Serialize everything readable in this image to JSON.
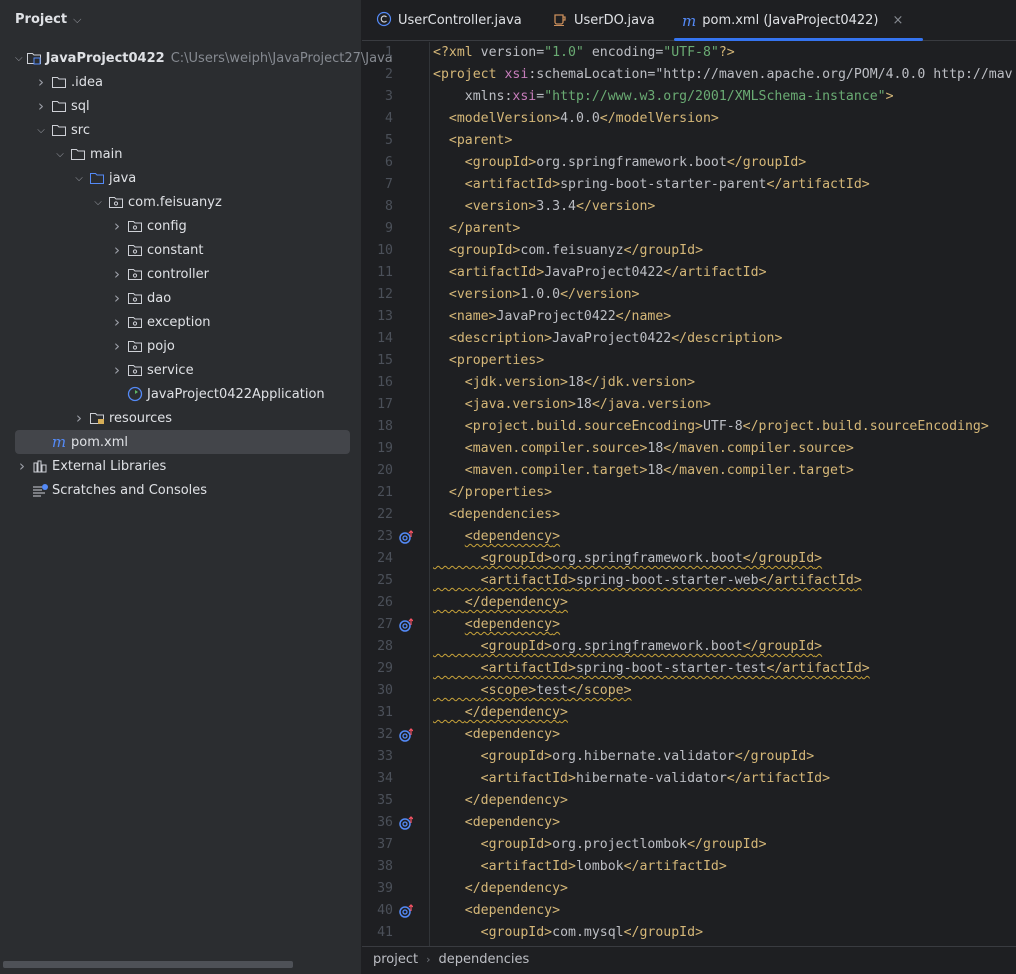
{
  "sidebar": {
    "title": "Project",
    "project_path": "C:\\Users\\weiph\\JavaProject27\\Java",
    "tree": [
      {
        "label": "JavaProject0422",
        "level": 0,
        "chevron": "down",
        "icon": "module-folder-icon",
        "bold": true
      },
      {
        "label": ".idea",
        "level": 1,
        "chevron": "right",
        "icon": "folder-icon"
      },
      {
        "label": "sql",
        "level": 1,
        "chevron": "right",
        "icon": "folder-icon"
      },
      {
        "label": "src",
        "level": 1,
        "chevron": "down",
        "icon": "folder-icon"
      },
      {
        "label": "main",
        "level": 2,
        "chevron": "down",
        "icon": "folder-icon"
      },
      {
        "label": "java",
        "level": 3,
        "chevron": "down",
        "icon": "source-folder-icon"
      },
      {
        "label": "com.feisuanyz",
        "level": 4,
        "chevron": "down",
        "icon": "package-icon"
      },
      {
        "label": "config",
        "level": 5,
        "chevron": "right",
        "icon": "package-icon"
      },
      {
        "label": "constant",
        "level": 5,
        "chevron": "right",
        "icon": "package-icon"
      },
      {
        "label": "controller",
        "level": 5,
        "chevron": "right",
        "icon": "package-icon"
      },
      {
        "label": "dao",
        "level": 5,
        "chevron": "right",
        "icon": "package-icon"
      },
      {
        "label": "exception",
        "level": 5,
        "chevron": "right",
        "icon": "package-icon"
      },
      {
        "label": "pojo",
        "level": 5,
        "chevron": "right",
        "icon": "package-icon"
      },
      {
        "label": "service",
        "level": 5,
        "chevron": "right",
        "icon": "package-icon"
      },
      {
        "label": "JavaProject0422Application",
        "level": 5,
        "chevron": "none",
        "icon": "spring-boot-class-icon"
      },
      {
        "label": "resources",
        "level": 3,
        "chevron": "right",
        "icon": "resources-folder-icon"
      },
      {
        "label": "pom.xml",
        "level": 1,
        "chevron": "none",
        "icon": "maven-icon",
        "selected": true
      },
      {
        "label": "External Libraries",
        "level": 0,
        "chevron": "right",
        "icon": "library-icon"
      },
      {
        "label": "Scratches and Consoles",
        "level": 0,
        "chevron": "none",
        "icon": "scratches-icon"
      }
    ]
  },
  "tabs": [
    {
      "label": "UserController.java",
      "icon": "class-icon"
    },
    {
      "label": "UserDO.java",
      "icon": "java-cup-icon"
    },
    {
      "label": "pom.xml (JavaProject0422)",
      "icon": "maven-icon",
      "active": true,
      "close": "×"
    }
  ],
  "colors": {
    "accent": "#3574f0",
    "tag": "#d5b778",
    "string": "#6aab73",
    "prefix": "#c77dbb",
    "text": "#bcbec4"
  },
  "editor": {
    "lines": [
      {
        "n": 1,
        "text": "<?xml version=\"1.0\" encoding=\"UTF-8\"?>"
      },
      {
        "n": 2,
        "text": "<project xsi:schemaLocation=\"http://maven.apache.org/POM/4.0.0 http://mav"
      },
      {
        "n": 3,
        "text": "    xmlns:xsi=\"http://www.w3.org/2001/XMLSchema-instance\">"
      },
      {
        "n": 4,
        "text": "  <modelVersion>4.0.0</modelVersion>"
      },
      {
        "n": 5,
        "text": "  <parent>"
      },
      {
        "n": 6,
        "text": "    <groupId>org.springframework.boot</groupId>"
      },
      {
        "n": 7,
        "text": "    <artifactId>spring-boot-starter-parent</artifactId>"
      },
      {
        "n": 8,
        "text": "    <version>3.3.4</version>"
      },
      {
        "n": 9,
        "text": "  </parent>"
      },
      {
        "n": 10,
        "text": "  <groupId>com.feisuanyz</groupId>"
      },
      {
        "n": 11,
        "text": "  <artifactId>JavaProject0422</artifactId>"
      },
      {
        "n": 12,
        "text": "  <version>1.0.0</version>"
      },
      {
        "n": 13,
        "text": "  <name>JavaProject0422</name>"
      },
      {
        "n": 14,
        "text": "  <description>JavaProject0422</description>"
      },
      {
        "n": 15,
        "text": "  <properties>"
      },
      {
        "n": 16,
        "text": "    <jdk.version>18</jdk.version>"
      },
      {
        "n": 17,
        "text": "    <java.version>18</java.version>"
      },
      {
        "n": 18,
        "text": "    <project.build.sourceEncoding>UTF-8</project.build.sourceEncoding>"
      },
      {
        "n": 19,
        "text": "    <maven.compiler.source>18</maven.compiler.source>"
      },
      {
        "n": 20,
        "text": "    <maven.compiler.target>18</maven.compiler.target>"
      },
      {
        "n": 21,
        "text": "  </properties>"
      },
      {
        "n": 22,
        "text": "  <dependencies>"
      },
      {
        "n": 23,
        "text": "    <dependency>",
        "gutter": "dependency-update-icon",
        "warn": "text"
      },
      {
        "n": 24,
        "text": "      <groupId>org.springframework.boot</groupId>",
        "warn": "full"
      },
      {
        "n": 25,
        "text": "      <artifactId>spring-boot-starter-web</artifactId>",
        "warn": "full"
      },
      {
        "n": 26,
        "text": "    </dependency>",
        "warn": "full"
      },
      {
        "n": 27,
        "text": "    <dependency>",
        "gutter": "dependency-update-icon",
        "warn": "text"
      },
      {
        "n": 28,
        "text": "      <groupId>org.springframework.boot</groupId>",
        "warn": "full"
      },
      {
        "n": 29,
        "text": "      <artifactId>spring-boot-starter-test</artifactId>",
        "warn": "full"
      },
      {
        "n": 30,
        "text": "      <scope>test</scope>",
        "warn": "full"
      },
      {
        "n": 31,
        "text": "    </dependency>",
        "warn": "full"
      },
      {
        "n": 32,
        "text": "    <dependency>",
        "gutter": "dependency-update-icon"
      },
      {
        "n": 33,
        "text": "      <groupId>org.hibernate.validator</groupId>"
      },
      {
        "n": 34,
        "text": "      <artifactId>hibernate-validator</artifactId>"
      },
      {
        "n": 35,
        "text": "    </dependency>"
      },
      {
        "n": 36,
        "text": "    <dependency>",
        "gutter": "dependency-update-icon"
      },
      {
        "n": 37,
        "text": "      <groupId>org.projectlombok</groupId>"
      },
      {
        "n": 38,
        "text": "      <artifactId>lombok</artifactId>"
      },
      {
        "n": 39,
        "text": "    </dependency>"
      },
      {
        "n": 40,
        "text": "    <dependency>",
        "gutter": "dependency-update-icon"
      },
      {
        "n": 41,
        "text": "      <groupId>com.mysql</groupId>"
      }
    ]
  },
  "breadcrumb": [
    "project",
    "dependencies"
  ]
}
